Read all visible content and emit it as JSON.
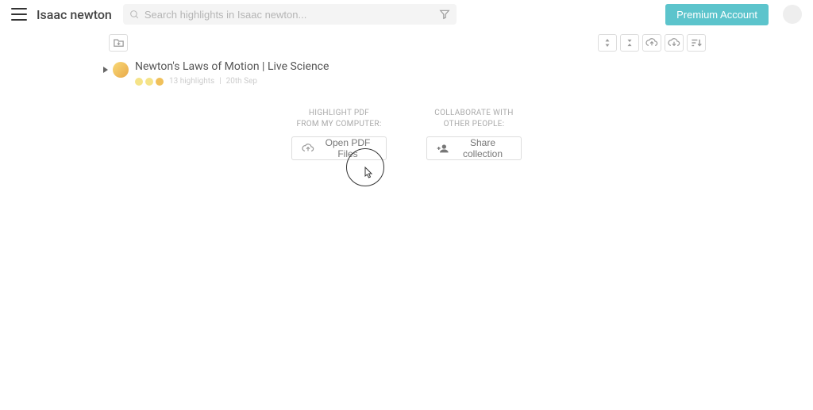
{
  "header": {
    "folder_title": "Isaac newton",
    "search_placeholder": "Search highlights in Isaac newton...",
    "premium_label": "Premium Account"
  },
  "item": {
    "title": "Newton's Laws of Motion | Live Science",
    "highlight_count": "13 highlights",
    "date": "20th Sep"
  },
  "actions": {
    "pdf_heading_line1": "HIGHLIGHT PDF",
    "pdf_heading_line2": "FROM MY COMPUTER:",
    "pdf_button": "Open PDF Files",
    "share_heading_line1": "COLLABORATE WITH",
    "share_heading_line2": "OTHER PEOPLE:",
    "share_button": "Share collection"
  }
}
